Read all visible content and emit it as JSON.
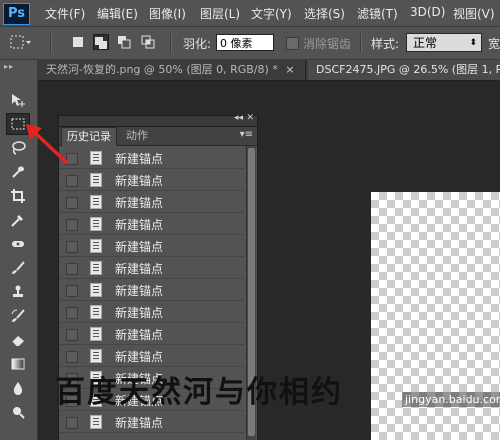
{
  "app": {
    "logo_text": "Ps"
  },
  "menu": [
    "文件(F)",
    "编辑(E)",
    "图像(I)",
    "图层(L)",
    "文字(Y)",
    "选择(S)",
    "滤镜(T)",
    "3D(D)",
    "视图(V)"
  ],
  "options_bar": {
    "feather_label": "羽化:",
    "feather_value": "0 像素",
    "antialias_label": "消除锯齿",
    "style_label": "样式:",
    "style_value": "正常",
    "width_label": "宽"
  },
  "document_tabs": [
    {
      "title": "天然河-恢复的.png @ 50% (图层 0, RGB/8) *",
      "close": "×",
      "active": false
    },
    {
      "title": "DSCF2475.JPG @ 26.5% (图层 1, RGB",
      "active": true
    }
  ],
  "tools": [
    {
      "icon": "move-tool-icon",
      "active": false
    },
    {
      "icon": "rectangular-marquee-tool-icon",
      "active": true
    },
    {
      "icon": "lasso-tool-icon",
      "active": false
    },
    {
      "icon": "quick-selection-tool-icon",
      "active": false
    },
    {
      "icon": "crop-tool-icon",
      "active": false
    },
    {
      "icon": "eyedropper-tool-icon",
      "active": false
    },
    {
      "icon": "healing-brush-tool-icon",
      "active": false
    },
    {
      "icon": "brush-tool-icon",
      "active": false
    },
    {
      "icon": "clone-stamp-tool-icon",
      "active": false
    },
    {
      "icon": "history-brush-tool-icon",
      "active": false
    },
    {
      "icon": "eraser-tool-icon",
      "active": false
    },
    {
      "icon": "gradient-tool-icon",
      "active": false
    },
    {
      "icon": "blur-tool-icon",
      "active": false
    },
    {
      "icon": "dodge-tool-icon",
      "active": false
    }
  ],
  "history_panel": {
    "tabs": [
      "历史记录",
      "动作"
    ],
    "active_tab": "历史记录",
    "items": [
      "新建锚点",
      "新建锚点",
      "新建锚点",
      "新建锚点",
      "新建锚点",
      "新建锚点",
      "新建锚点",
      "新建锚点",
      "新建锚点",
      "新建锚点",
      "新建锚点",
      "新建锚点",
      "新建锚点"
    ]
  },
  "watermark": {
    "text": "百度天然河与你相约",
    "site": "jingyan.baidu.com"
  },
  "colors": {
    "ui_dark": "#535353",
    "canvas_bg": "#282828",
    "arrow": "#e8231f",
    "ps_blue": "#4fb6ff"
  }
}
